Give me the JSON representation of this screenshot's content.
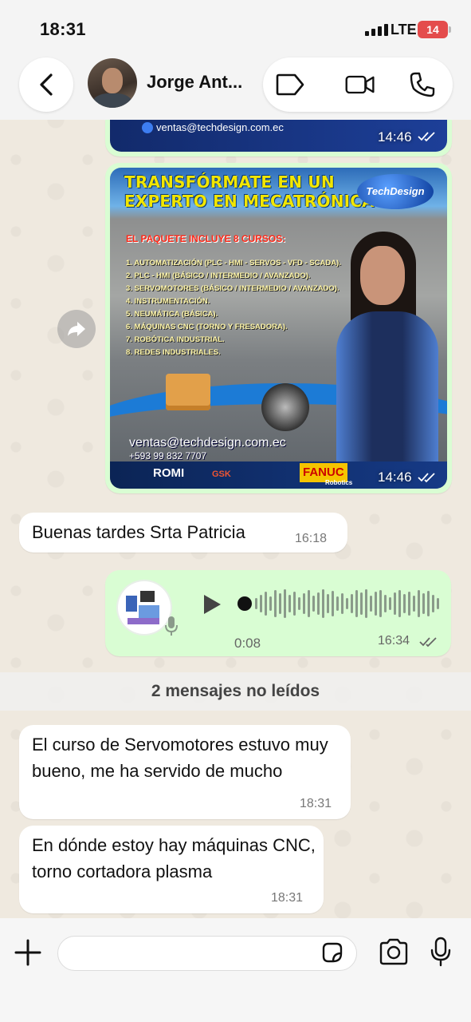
{
  "status_bar": {
    "time": "18:31",
    "network": "LTE",
    "battery": "14"
  },
  "header": {
    "contact_name": "Jorge Ant...",
    "icons": [
      "back-icon",
      "tag-icon",
      "video-call-icon",
      "phone-icon"
    ]
  },
  "messages": {
    "image_top": {
      "email": "ventas@techdesign.com.ec",
      "time": "14:46"
    },
    "image_main": {
      "title_line1": "TRANSFÓRMATE EN UN",
      "title_line2": "EXPERTO EN MECATRÓNICA",
      "brand": "TechDesign",
      "pack_title": "EL PAQUETE INCLUYE 8 CURSOS:",
      "courses": [
        "1. AUTOMATIZACIÓN (PLC - HMI - SERVOS - VFD - SCADA).",
        "2. PLC - HMI (BÁSICO / INTERMEDIO / AVANZADO).",
        "3. SERVOMOTORES (BÁSICO / INTERMEDIO / AVANZADO).",
        "4. INSTRUMENTACIÓN.",
        "5. NEUMÁTICA (BÁSICA).",
        "6. MÁQUINAS CNC (TORNO Y FRESADORA).",
        "7. ROBÓTICA INDUSTRIAL.",
        "8. REDES INDUSTRIALES."
      ],
      "email": "ventas@techdesign.com.ec",
      "phone": "+593 99 832 7707",
      "logos": [
        "ROMI",
        "GSK",
        "FANUC",
        "Robotics"
      ],
      "time": "14:46"
    },
    "greeting": {
      "text": "Buenas tardes Srta Patricia",
      "time": "16:18"
    },
    "voice_note": {
      "duration": "0:08",
      "time": "16:34"
    },
    "unread_divider": "2 mensajes no leídos",
    "incoming_1": {
      "text": "El curso de Servomotores estuvo muy bueno, me ha servido de mucho",
      "time": "18:31"
    },
    "incoming_2": {
      "text": "En dónde estoy hay máquinas CNC, torno cortadora plasma",
      "time": "18:31"
    }
  },
  "composer": {
    "input_value": "",
    "icons": [
      "plus-icon",
      "sticker-icon",
      "camera-icon",
      "microphone-icon"
    ]
  },
  "colors": {
    "outgoing_bubble": "#d9fdd3",
    "incoming_bubble": "#ffffff",
    "battery_low": "#e44c4c",
    "poster_title": "#f2e600"
  }
}
